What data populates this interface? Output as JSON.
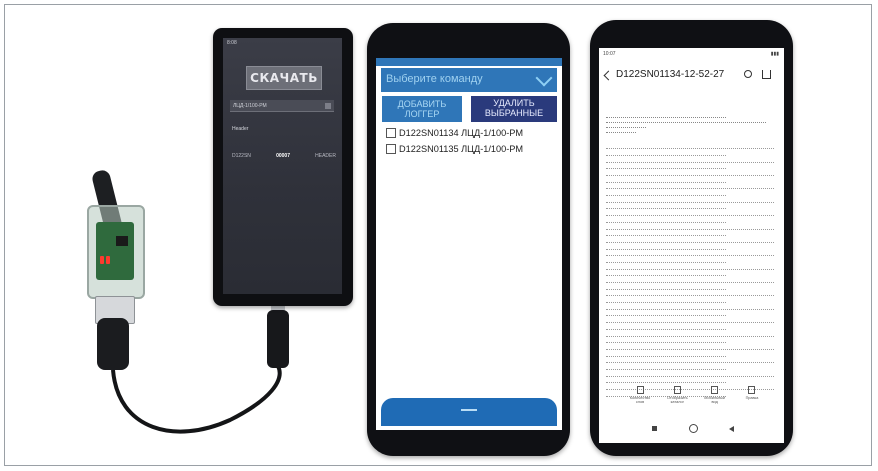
{
  "phone1": {
    "status_left": "8:08",
    "download_button": "СКАЧАТЬ",
    "logger_select": "ЛЦД-1/100-PM",
    "header_label": "Header",
    "row": {
      "id": "D122SN",
      "value": "00007",
      "col": "HEADER"
    }
  },
  "phone2": {
    "command_dropdown": "Выберите команду",
    "add_logger_button": "ДОБАВИТЬ ЛОГГЕР",
    "delete_selected_button": "УДАЛИТЬ ВЫБРАННЫЕ",
    "loggers": [
      "D122SN01134 ЛЦД-1/100-PM",
      "D122SN01135 ЛЦД-1/100-PM"
    ]
  },
  "phone3": {
    "status_time": "10:07",
    "title": "D122SN01134-12-52-27",
    "actions": [
      {
        "icon": "chart-icon",
        "label": "Количество слов"
      },
      {
        "icon": "list-icon",
        "label": "Отобразить каталог"
      },
      {
        "icon": "mobile-icon",
        "label": "Мобильный вид"
      },
      {
        "icon": "edit-icon",
        "label": "Правка"
      }
    ]
  }
}
